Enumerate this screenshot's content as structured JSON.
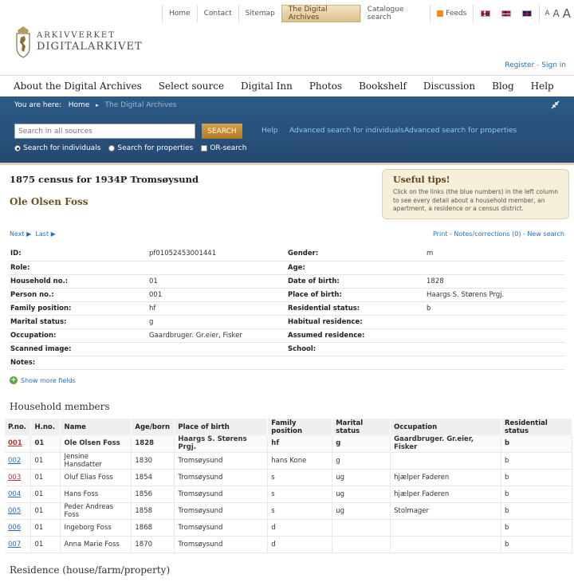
{
  "topbar": {
    "items": [
      "Home",
      "Contact",
      "Sitemap",
      "The Digital Archives",
      "Catalogue search"
    ],
    "feeds": "Feeds",
    "font_sizes": [
      "A",
      "A",
      "A"
    ]
  },
  "logo": {
    "line1": "ARKIVVERKET",
    "line2": "DIGITALARKIVET"
  },
  "account": {
    "register": "Register",
    "sep": "-",
    "signin": "Sign in"
  },
  "mainnav": [
    "About the Digital Archives",
    "Select source",
    "Digital Inn",
    "Photos",
    "Bookshelf",
    "Discussion",
    "Blog",
    "Help"
  ],
  "breadcrumb": {
    "prefix": "You are here:",
    "home": "Home",
    "current": "The Digital Archives"
  },
  "search": {
    "placeholder": "Search in all sources",
    "button": "SEARCH",
    "help": "Help",
    "adv_individuals": "Advanced search for individuals",
    "adv_properties": "Advanced search for properties",
    "opt_individuals": "Search for individuals",
    "opt_properties": "Search for properties",
    "opt_or": "OR-search"
  },
  "record": {
    "title": "1875 census for 1934P Tromsøysund",
    "name": "Ole Olsen Foss"
  },
  "tips": {
    "title": "Useful tips!",
    "body": "Click on the links (the blue numbers) in the left column to see every detail about a household member, an apartment, a residence or a census district."
  },
  "pager": {
    "next": "Next",
    "last": "Last"
  },
  "links": {
    "print": "Print",
    "notes": "Notes/corrections (0)",
    "new_search": "New search",
    "sep": "-"
  },
  "details": [
    {
      "l1": "ID:",
      "v1": "pf01052453001441",
      "l2": "Gender:",
      "v2": "m"
    },
    {
      "l1": "Role:",
      "v1": "",
      "l2": "Age:",
      "v2": ""
    },
    {
      "l1": "Household no.:",
      "v1": "01",
      "l2": "Date of birth:",
      "v2": "1828"
    },
    {
      "l1": "Person no.:",
      "v1": "001",
      "l2": "Place of birth:",
      "v2": "Haargs S. Størens Prgj."
    },
    {
      "l1": "Family position:",
      "v1": "hf",
      "l2": "Residential status:",
      "v2": "b"
    },
    {
      "l1": "Marital status:",
      "v1": "g",
      "l2": "Habitual residence:",
      "v2": ""
    },
    {
      "l1": "Occupation:",
      "v1": "Gaardbruger. Gr.eier, Fisker",
      "l2": "Assumed residence:",
      "v2": ""
    },
    {
      "l1": "Scanned image:",
      "v1": "",
      "l2": "School:",
      "v2": ""
    },
    {
      "l1": "Notes:",
      "v1": "",
      "l2": "",
      "v2": ""
    }
  ],
  "show_more": "Show more fields",
  "household": {
    "heading": "Household members",
    "columns": [
      "P.no.",
      "H.no.",
      "Name",
      "Age/born",
      "Place of birth",
      "Family position",
      "Marital status",
      "Occupation",
      "Residential status"
    ],
    "rows": [
      [
        "001",
        "01",
        "Ole Olsen Foss",
        "1828",
        "Haargs S. Størens Prgj.",
        "hf",
        "g",
        "Gaardbruger. Gr.eier, Fisker",
        "b"
      ],
      [
        "002",
        "01",
        "Jensine Hansdatter",
        "1830",
        "Tromsøysund",
        "hans Kone",
        "g",
        "",
        "b"
      ],
      [
        "003",
        "01",
        "Oluf Elias Foss",
        "1854",
        "Tromsøysund",
        "s",
        "ug",
        "hjælper Faderen",
        "b"
      ],
      [
        "004",
        "01",
        "Hans Foss",
        "1856",
        "Tromsøysund",
        "s",
        "ug",
        "hjælper Faderen",
        "b"
      ],
      [
        "005",
        "01",
        "Peder Andreas Foss",
        "1858",
        "Tromsøysund",
        "s",
        "ug",
        "Stolmager",
        "b"
      ],
      [
        "006",
        "01",
        "Ingeborg Foss",
        "1868",
        "Tromsøysund",
        "d",
        "",
        "",
        "b"
      ],
      [
        "007",
        "01",
        "Anna Marie Foss",
        "1870",
        "Tromsøysund",
        "d",
        "",
        "",
        "b"
      ]
    ]
  },
  "residence_heading": "Residence (house/farm/property)"
}
